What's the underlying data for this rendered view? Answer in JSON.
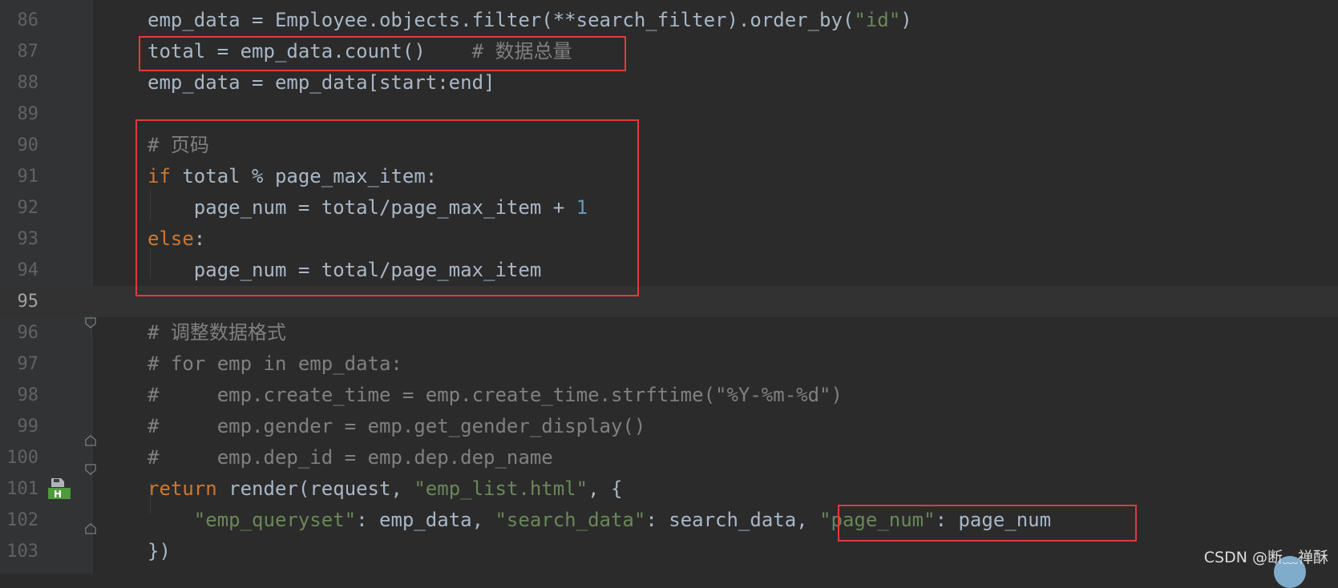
{
  "editor": {
    "lines": [
      {
        "num": "86",
        "tokens": [
          {
            "t": "emp_data = Employee.objects.filter(**search_filter).order_by(",
            "c": ""
          },
          {
            "t": "\"id\"",
            "c": "str"
          },
          {
            "t": ")",
            "c": ""
          }
        ]
      },
      {
        "num": "87",
        "tokens": [
          {
            "t": "total = emp_data.count()    ",
            "c": ""
          },
          {
            "t": "# 数据总量",
            "c": "cm"
          }
        ]
      },
      {
        "num": "88",
        "tokens": [
          {
            "t": "emp_data = emp_data[start:end]",
            "c": ""
          }
        ]
      },
      {
        "num": "89",
        "tokens": []
      },
      {
        "num": "90",
        "tokens": [
          {
            "t": "# 页码",
            "c": "cm"
          }
        ]
      },
      {
        "num": "91",
        "tokens": [
          {
            "t": "if",
            "c": "kw"
          },
          {
            "t": " total % page_max_item:",
            "c": ""
          }
        ]
      },
      {
        "num": "92",
        "tokens": [
          {
            "t": "    page_num = total/page_max_item + ",
            "c": ""
          },
          {
            "t": "1",
            "c": "num"
          }
        ]
      },
      {
        "num": "93",
        "tokens": [
          {
            "t": "else",
            "c": "kw"
          },
          {
            "t": ":",
            "c": ""
          }
        ]
      },
      {
        "num": "94",
        "tokens": [
          {
            "t": "    page_num = total/page_max_item",
            "c": ""
          }
        ]
      },
      {
        "num": "95",
        "tokens": []
      },
      {
        "num": "96",
        "tokens": [
          {
            "t": "# 调整数据格式",
            "c": "cm"
          }
        ]
      },
      {
        "num": "97",
        "tokens": [
          {
            "t": "# for emp in emp_data:",
            "c": "cm"
          }
        ]
      },
      {
        "num": "98",
        "tokens": [
          {
            "t": "#     emp.create_time = emp.create_time.strftime(\"%Y-%m-%d\")",
            "c": "cm"
          }
        ]
      },
      {
        "num": "99",
        "tokens": [
          {
            "t": "#     emp.gender = emp.get_gender_display()",
            "c": "cm"
          }
        ]
      },
      {
        "num": "100",
        "tokens": [
          {
            "t": "#     emp.dep_id = emp.dep.dep_name",
            "c": "cm"
          }
        ]
      },
      {
        "num": "101",
        "tokens": [
          {
            "t": "return",
            "c": "kw"
          },
          {
            "t": " render(request, ",
            "c": ""
          },
          {
            "t": "\"emp_list.html\"",
            "c": "str"
          },
          {
            "t": ", {",
            "c": ""
          }
        ]
      },
      {
        "num": "102",
        "tokens": [
          {
            "t": "    ",
            "c": ""
          },
          {
            "t": "\"emp_queryset\"",
            "c": "str"
          },
          {
            "t": ": emp_data, ",
            "c": ""
          },
          {
            "t": "\"search_data\"",
            "c": "str"
          },
          {
            "t": ": search_data, ",
            "c": ""
          },
          {
            "t": "\"page_num\"",
            "c": "str"
          },
          {
            "t": ": page_num",
            "c": ""
          }
        ]
      },
      {
        "num": "103",
        "tokens": [
          {
            "t": "})",
            "c": ""
          }
        ]
      }
    ],
    "current_line": "95"
  },
  "bookmark": {
    "letter": "H"
  },
  "watermark": "CSDN @断﹏禅酥",
  "colors": {
    "background": "#2b2b2b",
    "gutter": "#313335",
    "text": "#a9b7c6",
    "keyword": "#cc7832",
    "string": "#6a8759",
    "number": "#6897bb",
    "comment": "#808080",
    "highlight_box": "#e13a3a"
  }
}
